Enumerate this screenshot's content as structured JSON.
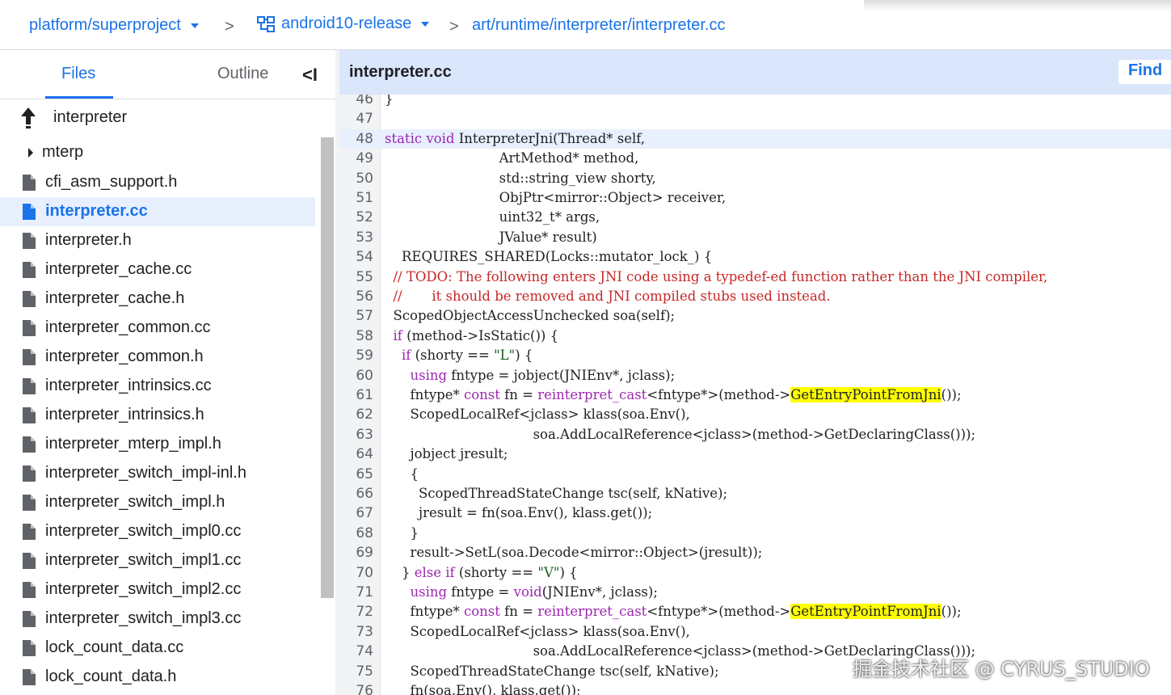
{
  "breadcrumb": {
    "project": "platform/superproject",
    "branch": "android10-release",
    "path": "art/runtime/interpreter/interpreter.cc",
    "separator": ">"
  },
  "left_panel": {
    "tabs": [
      {
        "label": "Files"
      },
      {
        "label": "Outline"
      }
    ],
    "collapse_glyph": "<I",
    "parent_folder": "interpreter",
    "items": [
      {
        "label": "mterp",
        "type": "folder"
      },
      {
        "label": "cfi_asm_support.h",
        "type": "file"
      },
      {
        "label": "interpreter.cc",
        "type": "file",
        "selected": true
      },
      {
        "label": "interpreter.h",
        "type": "file"
      },
      {
        "label": "interpreter_cache.cc",
        "type": "file"
      },
      {
        "label": "interpreter_cache.h",
        "type": "file"
      },
      {
        "label": "interpreter_common.cc",
        "type": "file"
      },
      {
        "label": "interpreter_common.h",
        "type": "file"
      },
      {
        "label": "interpreter_intrinsics.cc",
        "type": "file"
      },
      {
        "label": "interpreter_intrinsics.h",
        "type": "file"
      },
      {
        "label": "interpreter_mterp_impl.h",
        "type": "file"
      },
      {
        "label": "interpreter_switch_impl-inl.h",
        "type": "file"
      },
      {
        "label": "interpreter_switch_impl.h",
        "type": "file"
      },
      {
        "label": "interpreter_switch_impl0.cc",
        "type": "file"
      },
      {
        "label": "interpreter_switch_impl1.cc",
        "type": "file"
      },
      {
        "label": "interpreter_switch_impl2.cc",
        "type": "file"
      },
      {
        "label": "interpreter_switch_impl3.cc",
        "type": "file"
      },
      {
        "label": "lock_count_data.cc",
        "type": "file"
      },
      {
        "label": "lock_count_data.h",
        "type": "file"
      }
    ]
  },
  "code_view": {
    "filename": "interpreter.cc",
    "find_label": "Find",
    "highlighted_line": 48,
    "lines": [
      {
        "n": "46",
        "text": "}"
      },
      {
        "n": "47",
        "text": ""
      },
      {
        "n": "48",
        "text": "static void InterpreterJni(Thread* self,"
      },
      {
        "n": "49",
        "text": "                           ArtMethod* method,"
      },
      {
        "n": "50",
        "text": "                           std::string_view shorty,"
      },
      {
        "n": "51",
        "text": "                           ObjPtr<mirror::Object> receiver,"
      },
      {
        "n": "52",
        "text": "                           uint32_t* args,"
      },
      {
        "n": "53",
        "text": "                           JValue* result)"
      },
      {
        "n": "54",
        "text": "    REQUIRES_SHARED(Locks::mutator_lock_) {"
      },
      {
        "n": "55",
        "text": "  // TODO: The following enters JNI code using a typedef-ed function rather than the JNI compiler,"
      },
      {
        "n": "56",
        "text": "  //       it should be removed and JNI compiled stubs used instead."
      },
      {
        "n": "57",
        "text": "  ScopedObjectAccessUnchecked soa(self);"
      },
      {
        "n": "58",
        "text": "  if (method->IsStatic()) {"
      },
      {
        "n": "59",
        "text": "    if (shorty == \"L\") {"
      },
      {
        "n": "60",
        "text": "      using fntype = jobject(JNIEnv*, jclass);"
      },
      {
        "n": "61",
        "text": "      fntype* const fn = reinterpret_cast<fntype*>(method->GetEntryPointFromJni());"
      },
      {
        "n": "62",
        "text": "      ScopedLocalRef<jclass> klass(soa.Env(),"
      },
      {
        "n": "63",
        "text": "                                   soa.AddLocalReference<jclass>(method->GetDeclaringClass()));"
      },
      {
        "n": "64",
        "text": "      jobject jresult;"
      },
      {
        "n": "65",
        "text": "      {"
      },
      {
        "n": "66",
        "text": "        ScopedThreadStateChange tsc(self, kNative);"
      },
      {
        "n": "67",
        "text": "        jresult = fn(soa.Env(), klass.get());"
      },
      {
        "n": "68",
        "text": "      }"
      },
      {
        "n": "69",
        "text": "      result->SetL(soa.Decode<mirror::Object>(jresult));"
      },
      {
        "n": "70",
        "text": "    } else if (shorty == \"V\") {"
      },
      {
        "n": "71",
        "text": "      using fntype = void(JNIEnv*, jclass);"
      },
      {
        "n": "72",
        "text": "      fntype* const fn = reinterpret_cast<fntype*>(method->GetEntryPointFromJni());"
      },
      {
        "n": "73",
        "text": "      ScopedLocalRef<jclass> klass(soa.Env(),"
      },
      {
        "n": "74",
        "text": "                                   soa.AddLocalReference<jclass>(method->GetDeclaringClass()));"
      },
      {
        "n": "75",
        "text": "      ScopedThreadStateChange tsc(self, kNative);"
      },
      {
        "n": "76",
        "text": "      fn(soa.Env(), klass.get());"
      }
    ],
    "search_highlight": "GetEntryPointFromJni"
  },
  "watermark": "掘金技术社区 @ CYRUS_STUDIO",
  "colors": {
    "accent": "#1a73e8",
    "selected_bg": "#e8f0fe",
    "header_bg": "#d9e6fb",
    "keyword": "#9c27b0",
    "comment": "#c62828",
    "highlight": "#ffff00"
  }
}
